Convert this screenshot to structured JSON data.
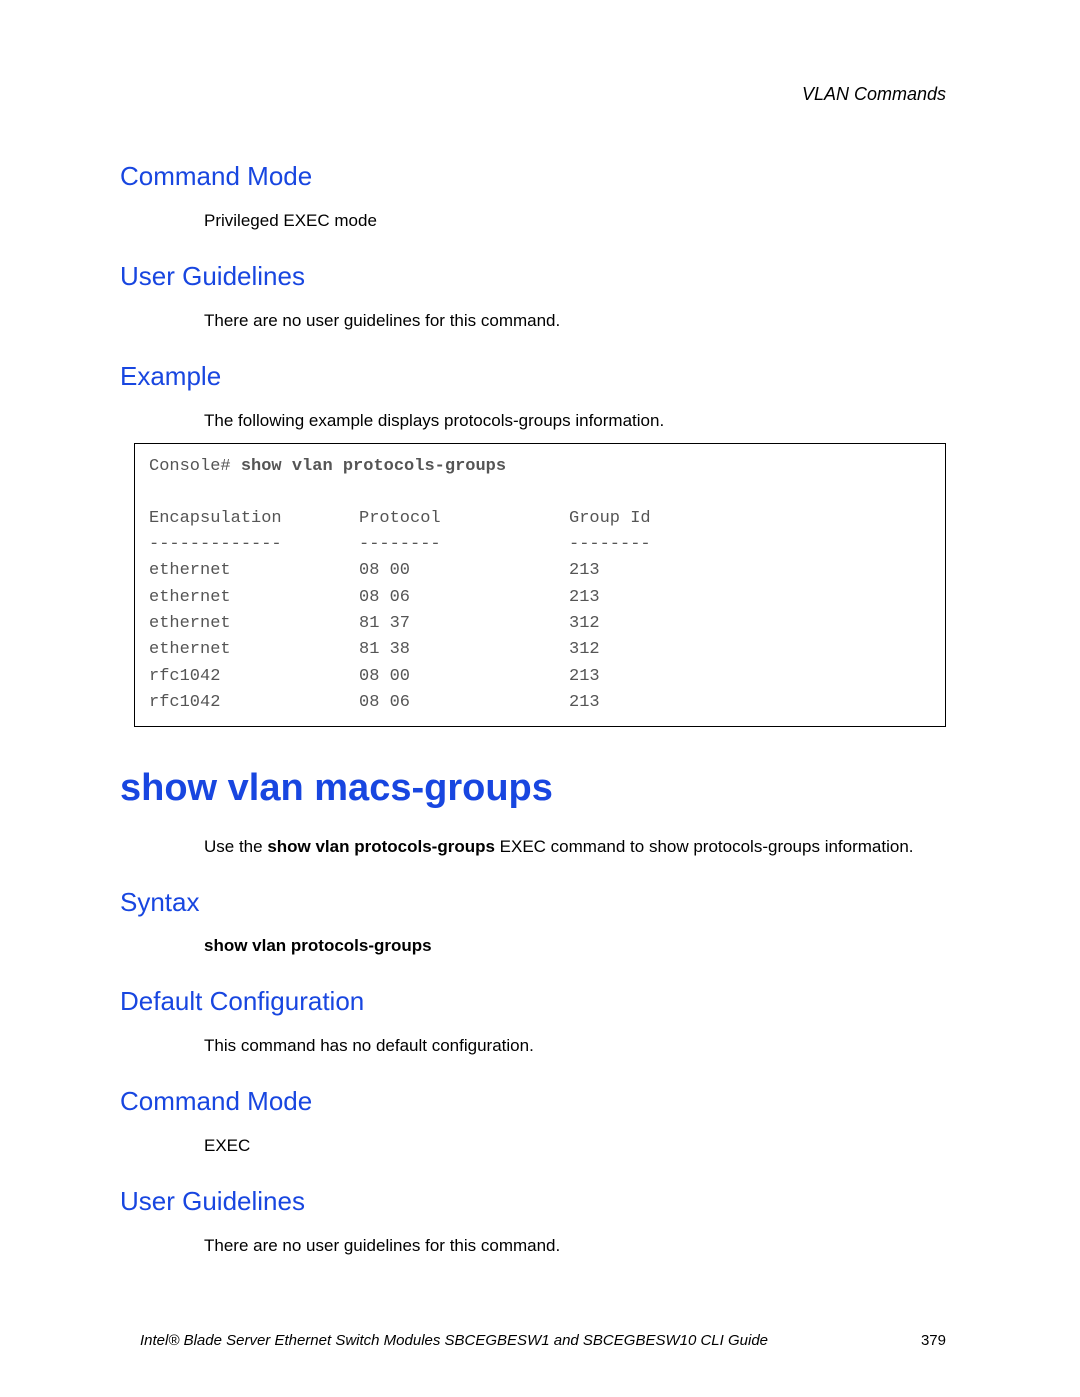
{
  "header": {
    "chapter": "VLAN Commands"
  },
  "sec1": {
    "command_mode": {
      "title": "Command Mode",
      "body": "Privileged EXEC mode"
    },
    "user_guidelines": {
      "title": "User Guidelines",
      "body": "There are no user guidelines for this command."
    },
    "example": {
      "title": "Example",
      "intro": "The following example displays protocols-groups information.",
      "prompt": "Console# ",
      "command": "show vlan protocols-groups",
      "cols": [
        "Encapsulation",
        "Protocol",
        "Group Id"
      ],
      "dash": [
        "-------------",
        "--------",
        "--------"
      ],
      "rows": [
        [
          "ethernet",
          "08 00",
          "213"
        ],
        [
          "ethernet",
          "08 06",
          "213"
        ],
        [
          "ethernet",
          "81 37",
          "312"
        ],
        [
          "ethernet",
          "81 38",
          "312"
        ],
        [
          "rfc1042",
          "08 00",
          "213"
        ],
        [
          "rfc1042",
          "08 06",
          "213"
        ]
      ]
    }
  },
  "sec2": {
    "title": "show vlan macs-groups",
    "desc_pre": "Use the ",
    "desc_bold": "show vlan protocols-groups",
    "desc_post": " EXEC command to show protocols-groups information.",
    "syntax": {
      "title": "Syntax",
      "line": "show vlan protocols-groups"
    },
    "default_cfg": {
      "title": "Default Configuration",
      "body": "This command has no default configuration."
    },
    "command_mode": {
      "title": "Command Mode",
      "body": "EXEC"
    },
    "user_guidelines": {
      "title": "User Guidelines",
      "body": "There are no user guidelines for this command."
    }
  },
  "footer": {
    "title": "Intel® Blade Server Ethernet Switch Modules SBCEGBESW1 and SBCEGBESW10 CLI Guide",
    "page": "379"
  }
}
